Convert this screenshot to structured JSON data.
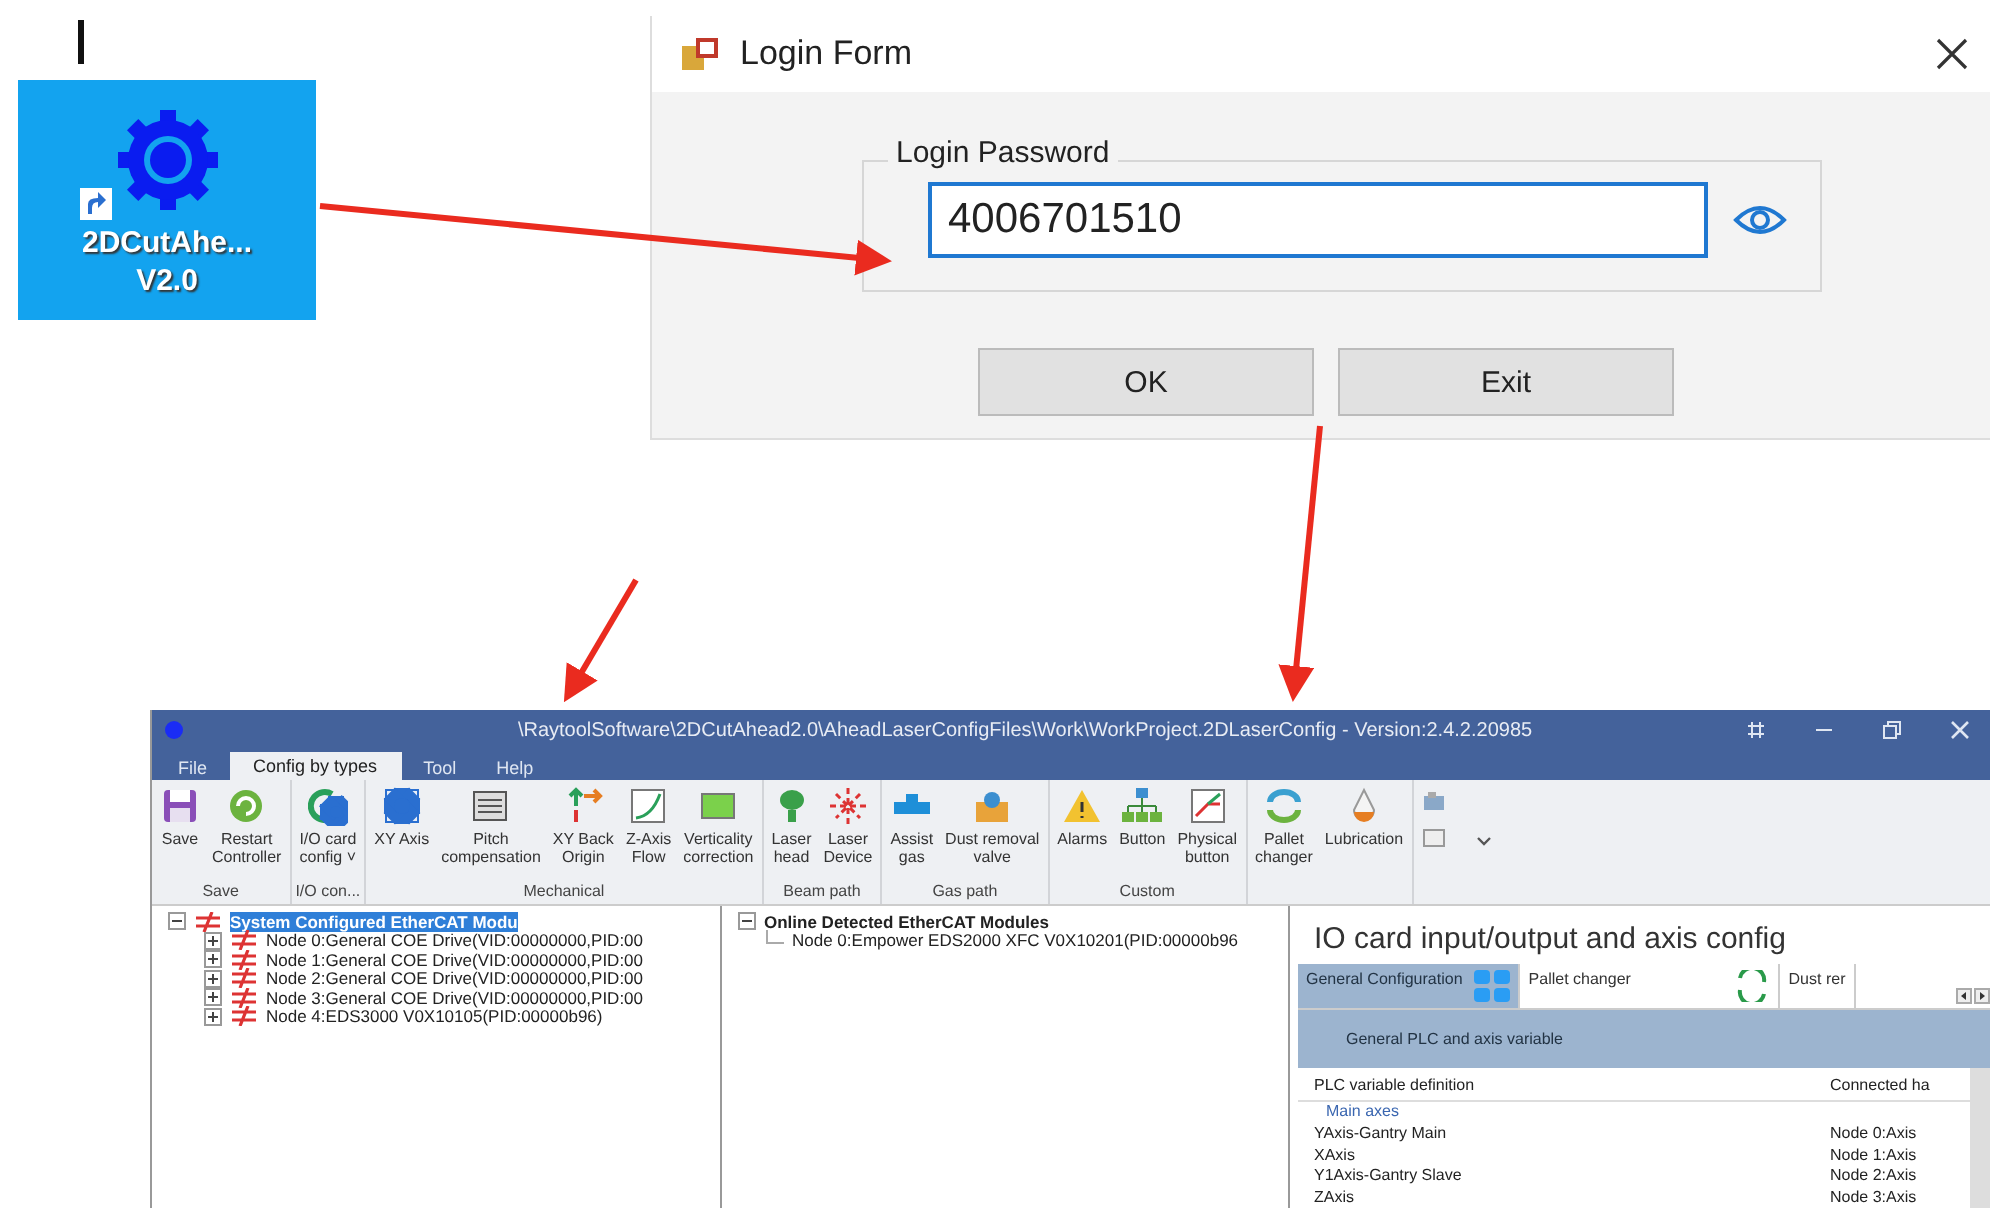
{
  "desktop_icon": {
    "label_lines": [
      "2DCutAhe...",
      "V2.0"
    ]
  },
  "login_form": {
    "title": "Login Form",
    "group_label": "Login Password",
    "password": "4006701510",
    "buttons": [
      "OK",
      "Exit"
    ]
  },
  "app_window": {
    "title": "\\RaytoolSoftware\\2DCutAhead2.0\\AheadLaserConfigFiles\\Work\\WorkProject.2DLaserConfig - Version:2.4.2.20985",
    "menu_tabs": [
      {
        "label": "File",
        "selected": false
      },
      {
        "label": "Config by types",
        "selected": true
      },
      {
        "label": "Tool",
        "selected": false
      },
      {
        "label": "Help",
        "selected": false
      }
    ],
    "ribbon_groups": [
      {
        "label": "Save",
        "items": [
          "Save",
          "Restart\nController"
        ]
      },
      {
        "label": "I/O con...",
        "items": [
          "I/O card\nconfig ˅"
        ]
      },
      {
        "label": "Mechanical",
        "items": [
          "XY Axis",
          "Pitch\ncompensation",
          "XY Back\nOrigin",
          "Z-Axis\nFlow",
          "Verticality\ncorrection"
        ]
      },
      {
        "label": "Beam path",
        "items": [
          "Laser\nhead",
          "Laser\nDevice"
        ]
      },
      {
        "label": "Gas path",
        "items": [
          "Assist\ngas",
          "Dust removal\nvalve"
        ]
      },
      {
        "label": "Custom",
        "items": [
          "Alarms",
          "Button",
          "Physical\nbutton"
        ]
      },
      {
        "items": [
          "Pallet\nchanger",
          "Lubrication"
        ]
      }
    ],
    "configured_tree": {
      "label": "System Configured EtherCAT Modu",
      "expanded": true,
      "selected": true,
      "children": [
        {
          "label": "Node 0:General COE Drive(VID:00000000,PID:00",
          "expanded": false
        },
        {
          "label": "Node 1:General COE Drive(VID:00000000,PID:00",
          "expanded": false
        },
        {
          "label": "Node 2:General COE Drive(VID:00000000,PID:00",
          "expanded": false
        },
        {
          "label": "Node 3:General COE Drive(VID:00000000,PID:00",
          "expanded": false
        },
        {
          "label": "Node 4:EDS3000 V0X10105(PID:00000b96)",
          "expanded": false
        }
      ]
    },
    "online_tree": {
      "label": "Online Detected EtherCAT Modules",
      "expanded": true,
      "children": [
        {
          "label": "Node 0:Empower EDS2000 XFC V0X10201(PID:00000b96"
        }
      ]
    },
    "io_panel": {
      "title": "IO card input/output and axis config",
      "tabs": [
        {
          "label": "General Configuration",
          "selected": true
        },
        {
          "label": "Pallet changer",
          "selected": false
        },
        {
          "label": "Dust rer",
          "selected": false
        }
      ],
      "subheader": "General PLC and axis variable",
      "columns": [
        "PLC variable definition",
        "Connected ha"
      ],
      "section": "Main axes",
      "rows": [
        [
          "YAxis-Gantry Main",
          "Node 0:Axis"
        ],
        [
          "XAxis",
          "Node 1:Axis"
        ],
        [
          "Y1Axis-Gantry Slave",
          "Node 2:Axis"
        ],
        [
          "ZAxis",
          "Node 3:Axis"
        ]
      ]
    }
  }
}
